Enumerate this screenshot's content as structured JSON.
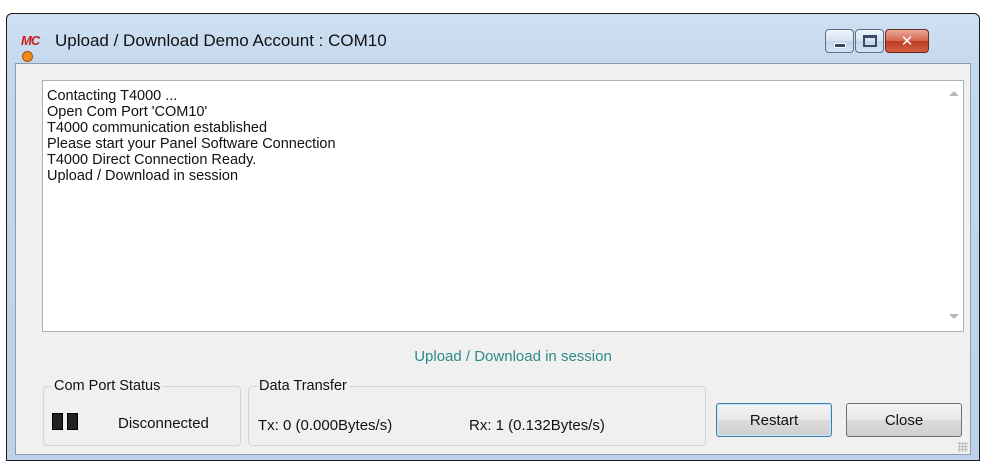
{
  "window": {
    "title": "Upload / Download Demo Account : COM10",
    "app_logo": "MC",
    "controls": [
      "minimize",
      "maximize",
      "close"
    ]
  },
  "log": {
    "lines": [
      "Contacting T4000 ...",
      "Open Com Port 'COM10'",
      "T4000 communication established",
      "Please start your Panel Software Connection",
      "T4000 Direct Connection Ready.",
      "Upload / Download in session"
    ]
  },
  "session_status": "Upload / Download in session",
  "com_port": {
    "legend": "Com Port Status",
    "status": "Disconnected"
  },
  "data_transfer": {
    "legend": "Data Transfer",
    "tx": "Tx: 0 (0.000Bytes/s)",
    "rx": "Rx: 1 (0.132Bytes/s)"
  },
  "buttons": {
    "restart": "Restart",
    "close": "Close"
  },
  "colors": {
    "session_status": "#2e8b8b",
    "close_button": "#c03c22"
  }
}
